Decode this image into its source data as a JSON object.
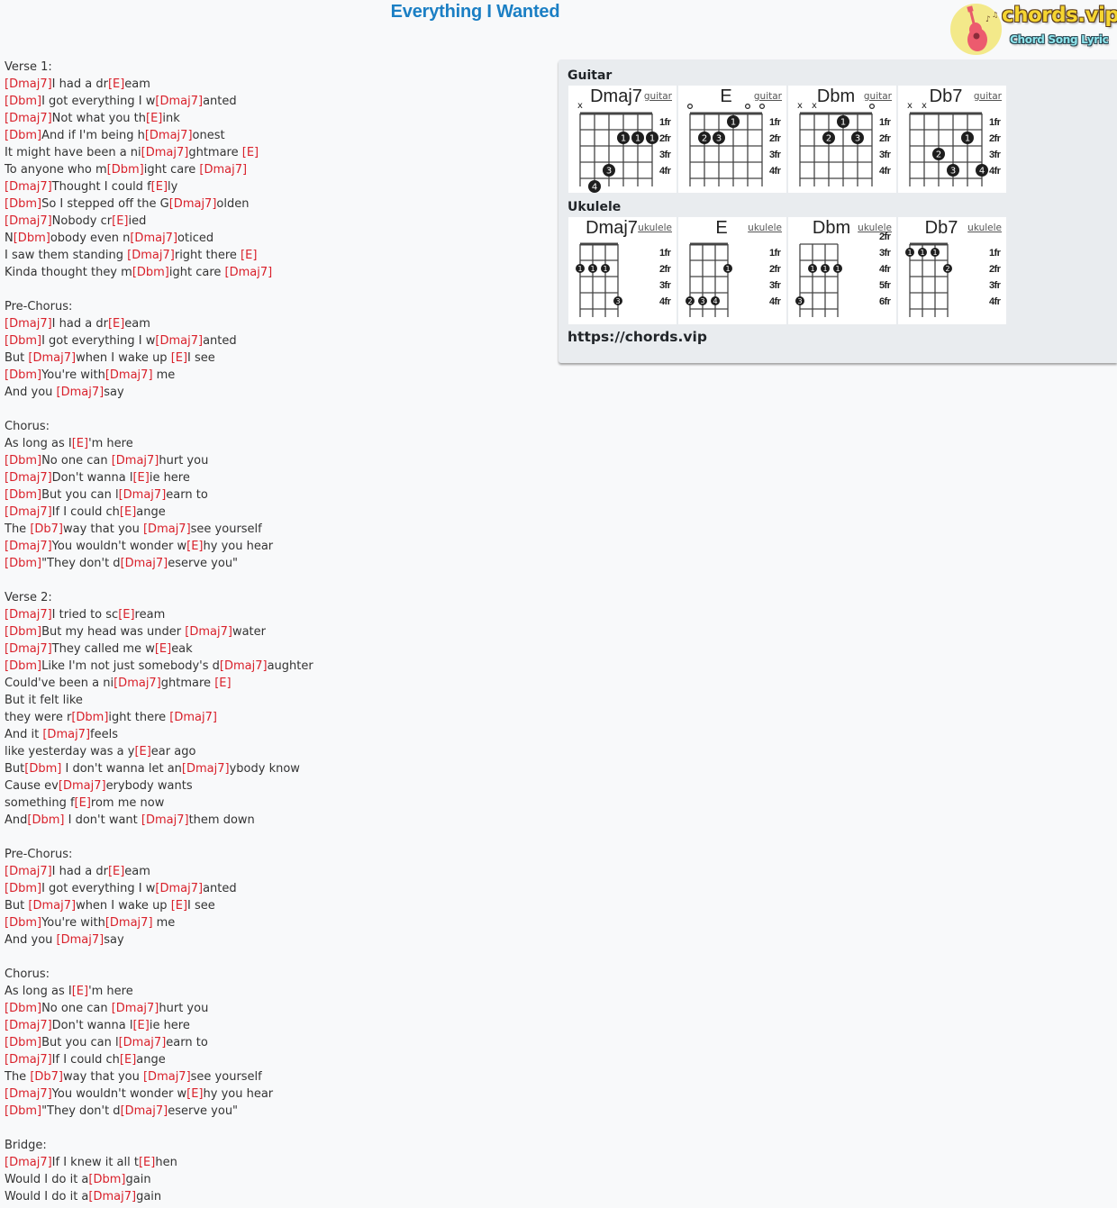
{
  "page": {
    "title": "Everything I Wanted",
    "logo": {
      "brand": "chords.vip",
      "tagline": "Chord Song Lyric"
    }
  },
  "colors": {
    "title": "#1b7fc4",
    "chord": "#d9212b",
    "text": "#333333",
    "panel": "#e9ecef"
  },
  "lyrics": {
    "sections": [
      {
        "label": "Verse 1:",
        "lines": [
          "[Dmaj7]I had a dr[E]eam",
          "[Dbm]I got everything I w[Dmaj7]anted",
          "[Dmaj7]Not what you th[E]ink",
          "[Dbm]And if I'm being h[Dmaj7]onest",
          "It might have been a ni[Dmaj7]ghtmare [E]",
          "To anyone who m[Dbm]ight care [Dmaj7]",
          "[Dmaj7]Thought I could f[E]ly",
          "[Dbm]So I stepped off the G[Dmaj7]olden",
          "[Dmaj7]Nobody cr[E]ied",
          "N[Dbm]obody even n[Dmaj7]oticed",
          "I saw them standing [Dmaj7]right there [E]",
          "Kinda thought they m[Dbm]ight care [Dmaj7]"
        ]
      },
      {
        "label": "Pre-Chorus:",
        "lines": [
          "[Dmaj7]I had a dr[E]eam",
          "[Dbm]I got everything I w[Dmaj7]anted",
          "But [Dmaj7]when I wake up [E]I see",
          "[Dbm]You're with[Dmaj7] me",
          "And you [Dmaj7]say"
        ]
      },
      {
        "label": "Chorus:",
        "lines": [
          "As long as I[E]'m here",
          "[Dbm]No one can [Dmaj7]hurt you",
          "[Dmaj7]Don't wanna l[E]ie here",
          "[Dbm]But you can l[Dmaj7]earn to",
          "[Dmaj7]If I could ch[E]ange",
          "The [Db7]way that you [Dmaj7]see yourself",
          "[Dmaj7]You wouldn't wonder w[E]hy you hear",
          "[Dbm]\"They don't d[Dmaj7]eserve you\""
        ]
      },
      {
        "label": "Verse 2:",
        "lines": [
          "[Dmaj7]I tried to sc[E]ream",
          "[Dbm]But my head was under [Dmaj7]water",
          "[Dmaj7]They called me w[E]eak",
          "[Dbm]Like I'm not just somebody's d[Dmaj7]aughter",
          "Could've been a ni[Dmaj7]ghtmare [E]",
          "But it felt like",
          "they were r[Dbm]ight there [Dmaj7]",
          "And it [Dmaj7]feels",
          "like yesterday was a y[E]ear ago",
          "But[Dbm] I don't wanna let an[Dmaj7]ybody know",
          "Cause ev[Dmaj7]erybody wants",
          "something f[E]rom me now",
          "And[Dbm] I don't want [Dmaj7]them down"
        ]
      },
      {
        "label": "Pre-Chorus:",
        "lines": [
          "[Dmaj7]I had a dr[E]eam",
          "[Dbm]I got everything I w[Dmaj7]anted",
          "But [Dmaj7]when I wake up [E]I see",
          "[Dbm]You're with[Dmaj7] me",
          "And you [Dmaj7]say"
        ]
      },
      {
        "label": "Chorus:",
        "lines": [
          "As long as I[E]'m here",
          "[Dbm]No one can [Dmaj7]hurt you",
          "[Dmaj7]Don't wanna l[E]ie here",
          "[Dbm]But you can l[Dmaj7]earn to",
          "[Dmaj7]If I could ch[E]ange",
          "The [Db7]way that you [Dmaj7]see yourself",
          "[Dmaj7]You wouldn't wonder w[E]hy you hear",
          "[Dbm]\"They don't d[Dmaj7]eserve you\""
        ]
      },
      {
        "label": "Bridge:",
        "lines": [
          "[Dmaj7]If I knew it all t[E]hen",
          "Would I do it a[Dbm]gain",
          "Would I do it a[Dmaj7]gain"
        ]
      }
    ]
  },
  "chord_panel": {
    "guitar_label": "Guitar",
    "ukulele_label": "Ukulele",
    "site_url": "https://chords.vip",
    "guitar": [
      {
        "name": "Dmaj7",
        "link": "guitar",
        "nut": true,
        "base_fret": 1,
        "fret_labels": [
          "1fr",
          "2fr",
          "3fr",
          "4fr"
        ],
        "muted": [
          1
        ],
        "open": [],
        "dots": [
          {
            "string": 4,
            "fret": 2,
            "finger": "1"
          },
          {
            "string": 5,
            "fret": 2,
            "finger": "1"
          },
          {
            "string": 6,
            "fret": 2,
            "finger": "1"
          },
          {
            "string": 3,
            "fret": 4,
            "finger": "3"
          },
          {
            "string": 2,
            "fret": 5,
            "finger": "4"
          }
        ]
      },
      {
        "name": "E",
        "link": "guitar",
        "nut": true,
        "base_fret": 1,
        "fret_labels": [
          "1fr",
          "2fr",
          "3fr",
          "4fr"
        ],
        "muted": [],
        "open": [
          1,
          5,
          6
        ],
        "dots": [
          {
            "string": 4,
            "fret": 1,
            "finger": "1"
          },
          {
            "string": 2,
            "fret": 2,
            "finger": "2"
          },
          {
            "string": 3,
            "fret": 2,
            "finger": "3"
          }
        ]
      },
      {
        "name": "Dbm",
        "link": "guitar",
        "nut": true,
        "base_fret": 1,
        "fret_labels": [
          "1fr",
          "2fr",
          "3fr",
          "4fr"
        ],
        "muted": [
          1,
          2
        ],
        "open": [
          6
        ],
        "dots": [
          {
            "string": 4,
            "fret": 1,
            "finger": "1"
          },
          {
            "string": 3,
            "fret": 2,
            "finger": "2"
          },
          {
            "string": 5,
            "fret": 2,
            "finger": "3"
          }
        ]
      },
      {
        "name": "Db7",
        "link": "guitar",
        "nut": true,
        "base_fret": 1,
        "fret_labels": [
          "1fr",
          "2fr",
          "3fr",
          "4fr"
        ],
        "muted": [
          1,
          2
        ],
        "open": [],
        "dots": [
          {
            "string": 5,
            "fret": 2,
            "finger": "1"
          },
          {
            "string": 3,
            "fret": 3,
            "finger": "2"
          },
          {
            "string": 4,
            "fret": 4,
            "finger": "3"
          },
          {
            "string": 6,
            "fret": 4,
            "finger": "4"
          }
        ]
      }
    ],
    "ukulele": [
      {
        "name": "Dmaj7",
        "link": "ukulele",
        "nut": true,
        "base_fret": 1,
        "fret_labels": [
          "1fr",
          "2fr",
          "3fr",
          "4fr"
        ],
        "muted": [],
        "open": [],
        "dots": [
          {
            "string": 1,
            "fret": 2,
            "finger": "1"
          },
          {
            "string": 2,
            "fret": 2,
            "finger": "1"
          },
          {
            "string": 3,
            "fret": 2,
            "finger": "1"
          },
          {
            "string": 4,
            "fret": 4,
            "finger": "3"
          }
        ]
      },
      {
        "name": "E",
        "link": "ukulele",
        "nut": true,
        "base_fret": 1,
        "fret_labels": [
          "1fr",
          "2fr",
          "3fr",
          "4fr"
        ],
        "muted": [],
        "open": [],
        "dots": [
          {
            "string": 4,
            "fret": 2,
            "finger": "1"
          },
          {
            "string": 1,
            "fret": 4,
            "finger": "2"
          },
          {
            "string": 2,
            "fret": 4,
            "finger": "3"
          },
          {
            "string": 3,
            "fret": 4,
            "finger": "4"
          }
        ]
      },
      {
        "name": "Dbm",
        "link": "ukulele",
        "nut": false,
        "base_fret": 3,
        "fret_labels": [
          "2fr",
          "3fr",
          "4fr",
          "5fr",
          "6fr"
        ],
        "muted": [],
        "open": [],
        "dots": [
          {
            "string": 2,
            "fret": 4,
            "finger": "1"
          },
          {
            "string": 3,
            "fret": 4,
            "finger": "1"
          },
          {
            "string": 4,
            "fret": 4,
            "finger": "1"
          },
          {
            "string": 1,
            "fret": 6,
            "finger": "3"
          }
        ]
      },
      {
        "name": "Db7",
        "link": "ukulele",
        "nut": true,
        "base_fret": 1,
        "fret_labels": [
          "1fr",
          "2fr",
          "3fr",
          "4fr"
        ],
        "muted": [],
        "open": [],
        "dots": [
          {
            "string": 1,
            "fret": 1,
            "finger": "1"
          },
          {
            "string": 2,
            "fret": 1,
            "finger": "1"
          },
          {
            "string": 3,
            "fret": 1,
            "finger": "1"
          },
          {
            "string": 4,
            "fret": 2,
            "finger": "2"
          }
        ]
      }
    ]
  }
}
